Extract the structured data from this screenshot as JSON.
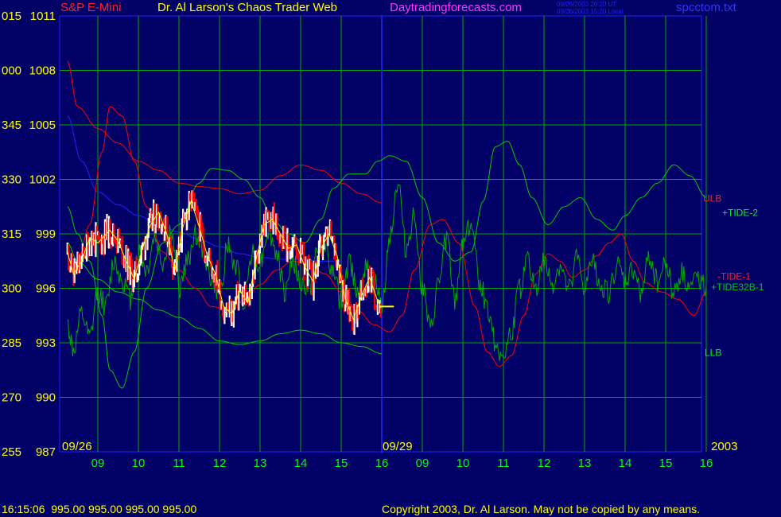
{
  "header": {
    "symbol": "S&P E-Mini",
    "title": "Dr. Al Larson's Chaos Trader Web",
    "site": "Daytradingforecasts.com",
    "time_ut": "09/26/2003 20:20 UT",
    "time_local": "09/26/2003 15:20 Local",
    "file": "spcctom.txt"
  },
  "footer": {
    "quote": "16:15:06  995.00 995.00 995.00 995.00",
    "copyright": "Copyright 2003, Dr. Al Larson. May not be copied by any means."
  },
  "colors": {
    "background": "#000066",
    "grid": "#00aa00",
    "axis_text": "#ffff00",
    "hour_text": "#00ff00",
    "price_up": "#ffffff",
    "price_down": "#ff0000",
    "average": "#ffff00",
    "band_red": "#ff0000",
    "band_green": "#00cc00",
    "blue_line": "#2222ff",
    "separator": "#2222ff"
  },
  "chart_data": {
    "type": "line",
    "xlabel": "",
    "ylabel": "",
    "ylim": [
      987,
      1011
    ],
    "y_ticks": [
      {
        "left": "255",
        "right": "987",
        "value": 987
      },
      {
        "left": "270",
        "right": "990",
        "value": 990
      },
      {
        "left": "285",
        "right": "993",
        "value": 993
      },
      {
        "left": "300",
        "right": "996",
        "value": 996
      },
      {
        "left": "315",
        "right": "999",
        "value": 999
      },
      {
        "left": "330",
        "right": "1002",
        "value": 1002
      },
      {
        "left": "345",
        "right": "1005",
        "value": 1005
      },
      {
        "left": "000",
        "right": "1008",
        "value": 1008
      },
      {
        "left": "015",
        "right": "1011",
        "value": 1011
      }
    ],
    "x_hours": [
      {
        "label": "09",
        "t": 1
      },
      {
        "label": "10",
        "t": 2
      },
      {
        "label": "11",
        "t": 3
      },
      {
        "label": "12",
        "t": 4
      },
      {
        "label": "13",
        "t": 5
      },
      {
        "label": "14",
        "t": 6
      },
      {
        "label": "15",
        "t": 7
      },
      {
        "label": "16",
        "t": 8
      },
      {
        "label": "09",
        "t": 9
      },
      {
        "label": "10",
        "t": 10
      },
      {
        "label": "11",
        "t": 11
      },
      {
        "label": "12",
        "t": 12
      },
      {
        "label": "13",
        "t": 13
      },
      {
        "label": "14",
        "t": 14
      },
      {
        "label": "15",
        "t": 15
      },
      {
        "label": "16",
        "t": 16
      }
    ],
    "xlim": [
      0.25,
      16.05
    ],
    "day_labels": [
      {
        "label": "09/26",
        "t": 0.3
      },
      {
        "label": "09/29",
        "t": 8.0
      },
      {
        "label": "2003",
        "t": 16.1
      }
    ],
    "day_separator_t": 8.0,
    "last_price": 995.0,
    "series": [
      {
        "name": "ULB",
        "color": "#ff0000",
        "x": [
          0.25,
          0.5,
          1,
          1.5,
          2,
          2.5,
          3,
          3.5,
          4,
          4.5,
          5,
          5.5,
          6,
          6.5,
          7,
          7.5,
          8
        ],
        "values": [
          1008.5,
          1006,
          1004.8,
          1004,
          1003,
          1002.5,
          1001.8,
          1001.6,
          1001.5,
          1001.2,
          1001.4,
          1002.2,
          1002.8,
          1002.5,
          1001.8,
          1001.2,
          1000.7
        ]
      },
      {
        "name": "LLB",
        "color": "#00cc00",
        "x": [
          0.25,
          0.5,
          1,
          1.5,
          2,
          2.5,
          3,
          3.5,
          4,
          4.5,
          5,
          5.5,
          6,
          6.5,
          7,
          7.5,
          8
        ],
        "values": [
          998.5,
          997.5,
          996.5,
          995.8,
          995.4,
          994.8,
          994.4,
          993.8,
          993.1,
          992.9,
          993.1,
          993.5,
          993.7,
          993.5,
          993.0,
          992.8,
          992.4
        ]
      },
      {
        "name": "BLUE",
        "color": "#2222ff",
        "x": [
          0.25,
          0.6,
          1,
          1.5,
          2,
          2.5,
          3,
          3.5,
          4,
          4.5,
          5,
          5.5,
          6,
          6.5,
          7
        ],
        "values": [
          1005.5,
          1003,
          1001.3,
          1000.6,
          1000,
          999.5,
          999.1,
          998.7,
          998.3,
          997.9,
          997.7,
          997.6,
          997.6,
          997.5,
          997.5
        ]
      },
      {
        "name": "+TIDE-2",
        "color": "#00cc00",
        "x": [
          0.25,
          0.5,
          0.8,
          1.1,
          1.3,
          1.6,
          1.9,
          2.2,
          2.6,
          3,
          3.5,
          3.8,
          4.2,
          4.6,
          5.0,
          5.3,
          5.7,
          6.1,
          6.5,
          6.8,
          7.2,
          7.6,
          7.9,
          8.2,
          8.6,
          9.0,
          9.4,
          9.8,
          10.2,
          10.5,
          10.8,
          11.1,
          11.4,
          11.7,
          12.1,
          12.5,
          12.9,
          13.3,
          13.7,
          14.0,
          14.4,
          14.8,
          15.2,
          15.6,
          16.0
        ],
        "values": [
          1000.5,
          999.0,
          997.5,
          994.5,
          991.5,
          990.5,
          992.5,
          996,
          998.5,
          999.5,
          1001.8,
          1002.6,
          1002.5,
          1002.0,
          1001.0,
          999.8,
          999.0,
          998.5,
          999.8,
          1001.5,
          1002.3,
          1002.3,
          1003.0,
          1003.3,
          1003.0,
          1001.0,
          998.5,
          997.5,
          998.0,
          1000.8,
          1003.8,
          1004.1,
          1002.8,
          1001.0,
          999.5,
          1000.5,
          1001.0,
          999.8,
          999.2,
          1000.0,
          1001.0,
          1001.8,
          1002.8,
          1002.2,
          1001.0
        ]
      },
      {
        "name": "-TIDE-1",
        "color": "#ff0000",
        "x": [
          0.25,
          0.5,
          0.8,
          1.1,
          1.3,
          1.6,
          1.9,
          2.2,
          2.6,
          3.0,
          3.4,
          3.8,
          4.2,
          4.6,
          5.0,
          5.4,
          5.8,
          6.2,
          6.6,
          7.0,
          7.4,
          7.8,
          8.2,
          8.5,
          8.8,
          9.2,
          9.5,
          9.9,
          10.3,
          10.6,
          10.9,
          11.2,
          11.5,
          11.8,
          12.1,
          12.4,
          12.7,
          13.0,
          13.3,
          13.6,
          13.9,
          14.2,
          14.5,
          14.9,
          15.3,
          15.7,
          16.0
        ],
        "values": [
          997.0,
          997.5,
          999.5,
          1003.5,
          1006.0,
          1005.5,
          1003.0,
          1000.5,
          998.0,
          997.0,
          996.0,
          995.0,
          994.8,
          995.3,
          996.2,
          997.0,
          997.5,
          997.3,
          996.8,
          995.8,
          994.8,
          994.0,
          993.6,
          994.5,
          997.0,
          999.5,
          999.8,
          998.5,
          995.0,
          992.5,
          991.7,
          992.3,
          994.5,
          996.8,
          997.9,
          997.5,
          996.6,
          997.0,
          997.8,
          998.5,
          999.0,
          997.5,
          996.3,
          995.8,
          995.4,
          994.5,
          995.8
        ]
      },
      {
        "name": "+TIDE32B-1",
        "color": "#00aa00",
        "x": [
          0.25,
          0.4,
          0.6,
          0.8,
          1.0,
          1.2,
          1.4,
          1.6,
          1.8,
          2.0,
          2.2,
          2.4,
          2.6,
          2.8,
          3.0,
          3.2,
          3.4,
          3.6,
          3.8,
          4.0,
          4.2,
          4.4,
          4.6,
          4.8,
          5.0,
          5.2,
          5.4,
          5.6,
          5.8,
          6.0,
          6.2,
          6.4,
          6.6,
          6.8,
          7.0,
          7.2,
          7.4,
          7.6,
          7.8,
          8.0,
          8.2,
          8.4,
          8.6,
          8.8,
          9.0,
          9.2,
          9.4,
          9.6,
          9.8,
          10.0,
          10.2,
          10.4,
          10.6,
          10.8,
          11.0,
          11.2,
          11.4,
          11.6,
          11.8,
          12.0,
          12.2,
          12.4,
          12.6,
          12.8,
          13.0,
          13.2,
          13.4,
          13.6,
          13.8,
          14.0,
          14.2,
          14.4,
          14.6,
          14.8,
          15.0,
          15.2,
          15.4,
          15.6,
          15.8,
          16.0
        ],
        "values": [
          994.0,
          992.6,
          994.5,
          993.2,
          995.8,
          995.0,
          997.5,
          996.5,
          995.4,
          998.0,
          997.0,
          998.8,
          997.4,
          999.2,
          996.0,
          997.4,
          999.0,
          998.0,
          996.5,
          995.6,
          998.3,
          997.2,
          995.4,
          998.0,
          997.4,
          999.2,
          998.0,
          995.8,
          997.6,
          996.2,
          996.0,
          997.8,
          998.6,
          996.8,
          995.2,
          997.4,
          996.0,
          997.0,
          996.4,
          995.0,
          999.0,
          1001.8,
          998.2,
          1000.0,
          996.0,
          993.6,
          996.2,
          998.8,
          995.2,
          998.6,
          999.6,
          996.5,
          995.0,
          993.0,
          992.2,
          993.6,
          996.0,
          997.5,
          996.0,
          997.4,
          996.2,
          997.2,
          995.8,
          997.6,
          996.0,
          997.4,
          996.2,
          995.8,
          997.2,
          996.4,
          997.0,
          995.8,
          997.8,
          996.4,
          997.4,
          995.8,
          996.8,
          996.0,
          996.6,
          996.2
        ]
      }
    ],
    "price_anchors": {
      "t": [
        0.25,
        0.4,
        0.6,
        0.8,
        1.0,
        1.3,
        1.5,
        1.7,
        1.9,
        2.1,
        2.3,
        2.5,
        2.7,
        2.9,
        3.1,
        3.3,
        3.5,
        3.7,
        3.9,
        4.1,
        4.3,
        4.5,
        4.7,
        4.9,
        5.1,
        5.3,
        5.5,
        5.7,
        5.9,
        6.1,
        6.3,
        6.5,
        6.7,
        6.9,
        7.1,
        7.3,
        7.5,
        7.7,
        7.9,
        8.0
      ],
      "values": [
        998.0,
        996.8,
        997.5,
        998.8,
        998.5,
        999.2,
        998.6,
        997.5,
        996.5,
        998.2,
        999.5,
        1000.2,
        999.0,
        997.0,
        999.4,
        1000.8,
        999.4,
        997.8,
        996.8,
        995.0,
        994.6,
        995.9,
        995.2,
        997.6,
        999.5,
        999.8,
        999.0,
        998.2,
        998.4,
        997.2,
        996.4,
        998.2,
        999.0,
        997.8,
        995.4,
        994.3,
        995.6,
        996.6,
        995.3,
        994.8
      ]
    }
  },
  "series_labels": [
    {
      "text": "ULB",
      "color": "#ff2222",
      "value": 1001.0
    },
    {
      "text": "+TIDE-2",
      "color": "#00ff00",
      "value": 1000.2
    },
    {
      "text": "-TIDE-1",
      "color": "#ff2222",
      "value": 996.7
    },
    {
      "text": "+TIDE32B-1",
      "color": "#00cc00",
      "value": 996.1
    },
    {
      "text": "LLB",
      "color": "#00ff00",
      "value": 992.5
    }
  ]
}
